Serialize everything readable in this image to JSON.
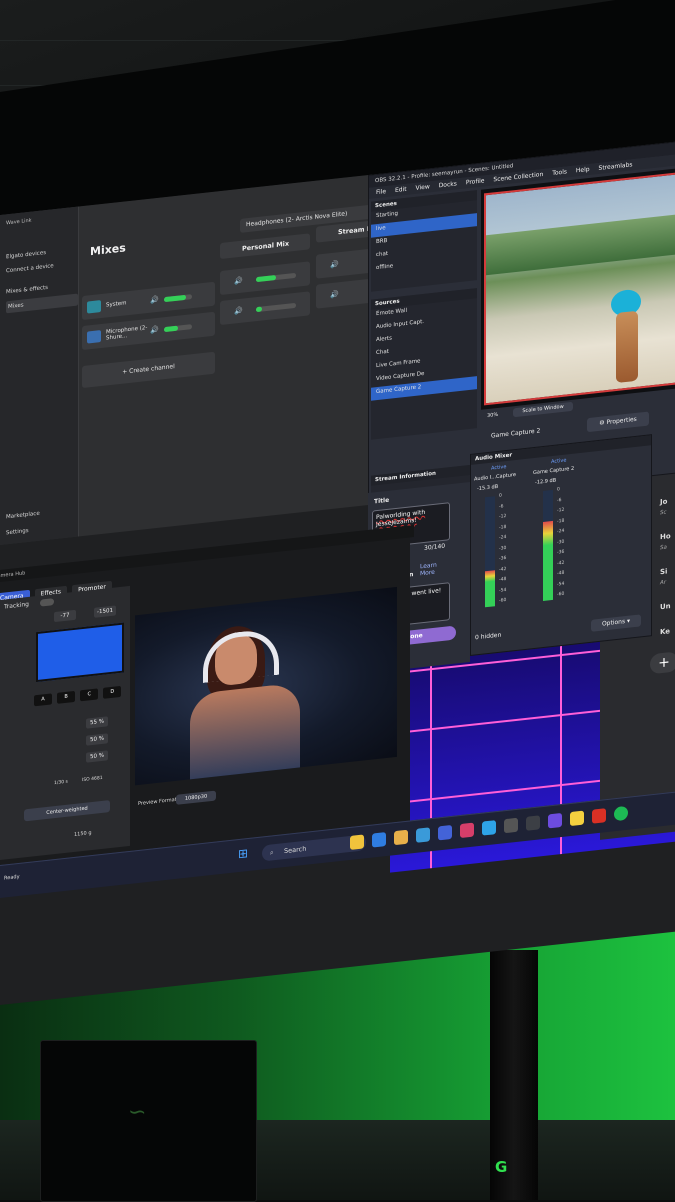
{
  "wavelink": {
    "title": "Wave Link",
    "nav": [
      "Elgato devices",
      "Connect a device",
      "Mixes & effects",
      "Mixes",
      "Marketplace",
      "Settings"
    ],
    "heading": "Mixes",
    "output_device": "Headphones (2- Arctis Nova Elite)",
    "mix_columns": [
      "Personal Mix",
      "Stream Mix"
    ],
    "channels": [
      {
        "name": "System"
      },
      {
        "name": "Microphone (2- Shure..."
      }
    ],
    "create_channel": "Create channel"
  },
  "obs": {
    "titlebar": "OBS 32.2.1 - Profile: seemayrun - Scenes: Untitled",
    "menu": [
      "File",
      "Edit",
      "View",
      "Docks",
      "Profile",
      "Scene Collection",
      "Tools",
      "Help",
      "Streamlabs"
    ],
    "scenes_title": "Scenes",
    "scenes": [
      "Starting",
      "live",
      "BRB",
      "chat",
      "offline"
    ],
    "sources_title": "Sources",
    "sources": [
      "Emote Wall",
      "Audio Input Capt.",
      "Alerts",
      "Chat",
      "Live Cam Frame",
      "Video Capture De",
      "Game Capture 2"
    ],
    "zoom": "30%",
    "scale_mode": "Scale to Window",
    "selected_source": "Game Capture 2",
    "properties": "Properties",
    "stream_info": {
      "title": "Stream Information",
      "title_label": "Title",
      "title_value": "Palworlding with JesseJezaims!",
      "char_count": "30/140",
      "go_live_label": "Go Live Notification",
      "learn_more": "Learn More",
      "notification_value": "seemayrun went live!",
      "done": "Done"
    },
    "audio_mixer": {
      "title": "Audio Mixer",
      "channels": [
        {
          "name": "Audio I...Capture",
          "status": "Active",
          "db": "-15.3 dB",
          "level": 0.33
        },
        {
          "name": "Game Capture 2",
          "status": "Active",
          "db": "-12.9 dB",
          "level": 0.72
        }
      ],
      "scale": [
        "0",
        "-6",
        "-12",
        "-18",
        "-24",
        "-30",
        "-36",
        "-42",
        "-48",
        "-54",
        "-60"
      ],
      "hidden": "0 hidden",
      "options": "Options"
    }
  },
  "camerahub": {
    "title": "Camera Hub",
    "tabs": [
      "Camera",
      "Effects",
      "Prompter"
    ],
    "tracking": "Tracking",
    "zoom_values": [
      "-77",
      "-1501"
    ],
    "presets": [
      "A",
      "B",
      "C",
      "D"
    ],
    "percents": [
      "55 %",
      "50 %",
      "50 %"
    ],
    "metering": "Center-weighted",
    "shutter_value": "1/30 s",
    "iso_value": "ISO 4681",
    "gain": "1150 g",
    "preview_format_label": "Preview Format",
    "preview_format": "1080p30"
  },
  "taskbar": {
    "search": "Search"
  },
  "status_text": "Ready",
  "colors": {
    "accent_blue": "#2f65c8",
    "meter_green": "#34d058",
    "done_purple": "#8f6ad2",
    "ambient_green": "#16a134"
  }
}
